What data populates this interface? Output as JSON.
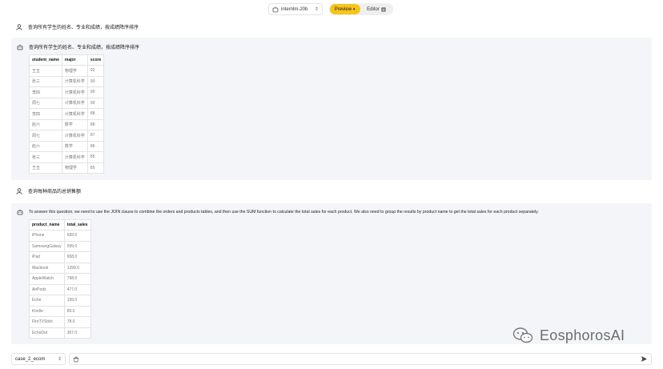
{
  "header": {
    "model": "internlm-20b",
    "preview_label": "Preview",
    "editor_label": "Editor"
  },
  "conversation": [
    {
      "user_text": "查询所有学生的姓名、专业和成绩，按成绩降序排序",
      "bot_text": "查询所有学生的姓名、专业和成绩，按成绩降序排序",
      "table": {
        "columns": [
          "student_name",
          "major",
          "score"
        ],
        "rows": [
          [
            "王五",
            "物理学",
            "92"
          ],
          [
            "张三",
            "计算机科学",
            "90"
          ],
          [
            "李四",
            "计算机科学",
            "90"
          ],
          [
            "周七",
            "计算机科学",
            "90"
          ],
          [
            "李四",
            "计算机科学",
            "88"
          ],
          [
            "赵六",
            "数学",
            "88"
          ],
          [
            "周七",
            "计算机科学",
            "87"
          ],
          [
            "赵六",
            "数学",
            "86"
          ],
          [
            "张三",
            "计算机科学",
            "85"
          ],
          [
            "王五",
            "物理学",
            "85"
          ]
        ]
      }
    },
    {
      "user_text": "查询每种商品的总销售额",
      "bot_text": "To answer this question, we need to use the JOIN clause to combine the orders and products tables, and then use the SUM function to calculate the total sales for each product. We also need to group the results by product name to get the total sales for each product separately.",
      "table": {
        "columns": [
          "product_name",
          "total_sales"
        ],
        "rows": [
          [
            "iPhone",
            "699.0"
          ],
          [
            "SamsungGalaxy",
            "599.0"
          ],
          [
            "iPad",
            "658.0"
          ],
          [
            "Macbook",
            "1299.0"
          ],
          [
            "AppleWatch",
            "798.0"
          ],
          [
            "AirPods",
            "477.0"
          ],
          [
            "Echo",
            "199.0"
          ],
          [
            "Kindle",
            "89.0"
          ],
          [
            "FireTVStick",
            "78.0"
          ],
          [
            "EchoDot",
            "367.0"
          ]
        ]
      }
    }
  ],
  "footer": {
    "case_select": "case_2_ecom",
    "input_value": "",
    "input_placeholder": ""
  },
  "watermark": {
    "text": "EosphorosAI"
  }
}
